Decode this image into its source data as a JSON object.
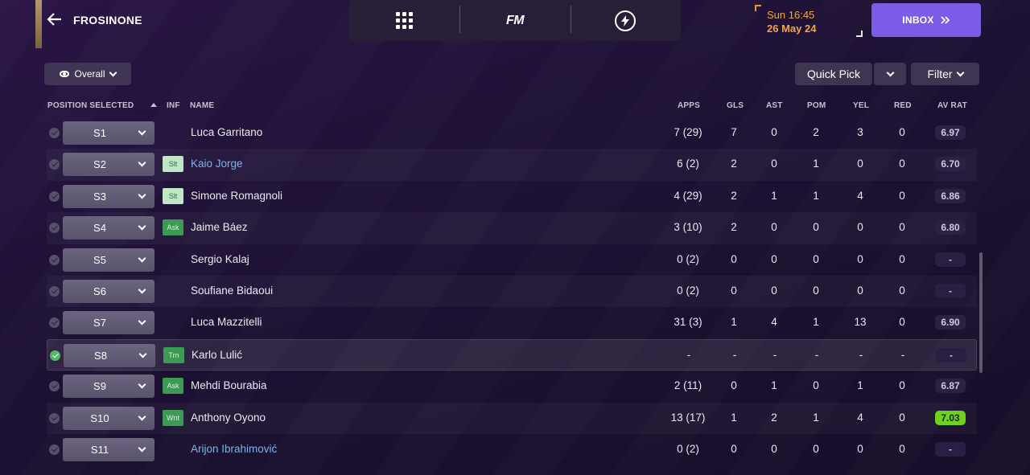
{
  "header": {
    "club_name": "FROSINONE",
    "date_time": "Sun 16:45",
    "date_day": "26 May 24",
    "inbox_label": "INBOX",
    "fm_label": "FM"
  },
  "controls": {
    "view_label": "Overall",
    "quick_pick_label": "Quick Pick",
    "filter_label": "Filter"
  },
  "columns": {
    "position": "POSITION SELECTED",
    "inf": "INF",
    "name": "NAME",
    "apps": "APPS",
    "gls": "GLS",
    "ast": "AST",
    "pom": "POM",
    "yel": "YEL",
    "red": "RED",
    "avrat": "AV RAT"
  },
  "rows": [
    {
      "pos": "S1",
      "inf": "",
      "name": "Luca Garritano",
      "apps": "7 (29)",
      "gls": "7",
      "ast": "0",
      "pom": "2",
      "yel": "3",
      "red": "0",
      "rat": "6.97"
    },
    {
      "pos": "S2",
      "inf": "Slt",
      "name": "Kaio Jorge",
      "apps": "6 (2)",
      "gls": "2",
      "ast": "0",
      "pom": "1",
      "yel": "0",
      "red": "0",
      "rat": "6.70"
    },
    {
      "pos": "S3",
      "inf": "Slt",
      "name": "Simone Romagnoli",
      "apps": "4 (29)",
      "gls": "2",
      "ast": "1",
      "pom": "1",
      "yel": "4",
      "red": "0",
      "rat": "6.86"
    },
    {
      "pos": "S4",
      "inf": "Ask",
      "name": "Jaime Báez",
      "apps": "3 (10)",
      "gls": "2",
      "ast": "0",
      "pom": "0",
      "yel": "0",
      "red": "0",
      "rat": "6.80"
    },
    {
      "pos": "S5",
      "inf": "",
      "name": "Sergio Kalaj",
      "apps": "0 (2)",
      "gls": "0",
      "ast": "0",
      "pom": "0",
      "yel": "0",
      "red": "0",
      "rat": "-"
    },
    {
      "pos": "S6",
      "inf": "",
      "name": "Soufiane Bidaoui",
      "apps": "0 (2)",
      "gls": "0",
      "ast": "0",
      "pom": "0",
      "yel": "0",
      "red": "0",
      "rat": "-"
    },
    {
      "pos": "S7",
      "inf": "",
      "name": "Luca Mazzitelli",
      "apps": "31 (3)",
      "gls": "1",
      "ast": "4",
      "pom": "1",
      "yel": "13",
      "red": "0",
      "rat": "6.90"
    },
    {
      "pos": "S8",
      "inf": "Trn",
      "name": "Karlo Lulić",
      "apps": "-",
      "gls": "-",
      "ast": "-",
      "pom": "-",
      "yel": "-",
      "red": "-",
      "rat": "-"
    },
    {
      "pos": "S9",
      "inf": "Ask",
      "name": "Mehdi Bourabia",
      "apps": "2 (11)",
      "gls": "0",
      "ast": "1",
      "pom": "0",
      "yel": "1",
      "red": "0",
      "rat": "6.87"
    },
    {
      "pos": "S10",
      "inf": "Wnt",
      "name": "Anthony Oyono",
      "apps": "13 (17)",
      "gls": "1",
      "ast": "2",
      "pom": "1",
      "yel": "4",
      "red": "0",
      "rat": "7.03"
    },
    {
      "pos": "S11",
      "inf": "",
      "name": "Arijon Ibrahimović",
      "apps": "0 (2)",
      "gls": "0",
      "ast": "0",
      "pom": "0",
      "yel": "0",
      "red": "0",
      "rat": "-"
    }
  ],
  "colors": {
    "accent": "#7b5ce6",
    "date": "#f0a845",
    "link": "#7fb4ea",
    "good_rating": "#6fd21e",
    "interest_green": "#3d9a55"
  }
}
